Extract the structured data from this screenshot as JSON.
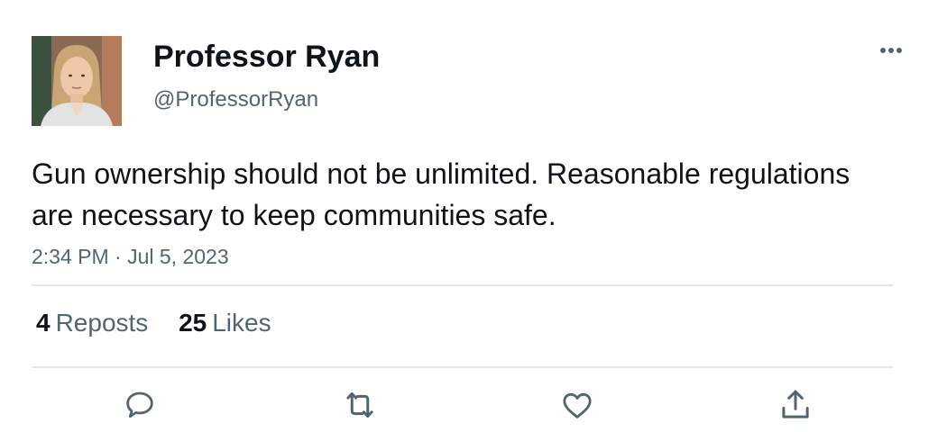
{
  "author": {
    "display_name": "Professor Ryan",
    "handle": "@ProfessorRyan",
    "avatar_icon": "profile-photo"
  },
  "tweet": {
    "text": "Gun ownership should not be unlimited. Reasonable regulations are necessary to keep communities safe.",
    "timestamp": "2:34 PM · Jul 5, 2023"
  },
  "stats": {
    "reposts_count": "4",
    "reposts_label": "Reposts",
    "likes_count": "25",
    "likes_label": "Likes"
  },
  "actions": [
    {
      "name": "reply",
      "icon": "speech-bubble-icon"
    },
    {
      "name": "repost",
      "icon": "repost-arrows-icon"
    },
    {
      "name": "like",
      "icon": "heart-icon"
    },
    {
      "name": "share",
      "icon": "share-upload-icon"
    }
  ],
  "colors": {
    "primary_text": "#0f1419",
    "secondary_text": "#536471",
    "divider": "#e1e6ea",
    "icon": "#536471"
  }
}
